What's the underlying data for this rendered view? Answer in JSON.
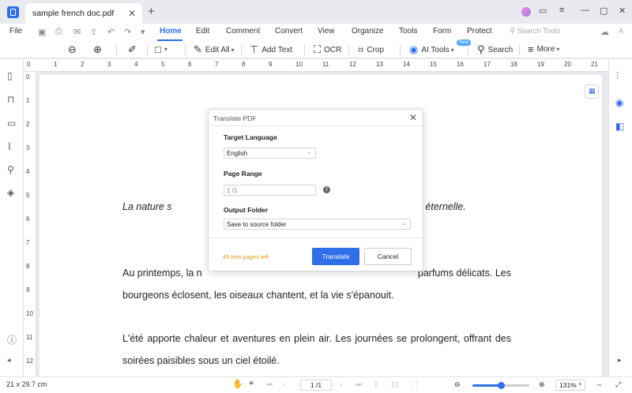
{
  "titlebar": {
    "tab_title": "sample french doc.pdf",
    "close_glyph": "✕",
    "new_tab_glyph": "+",
    "controls": {
      "feedback": "▭",
      "menu": "≡",
      "minimize": "—",
      "maximize": "▢",
      "close": "✕"
    }
  },
  "menubar": {
    "file": "File",
    "tabs": [
      "Home",
      "Edit",
      "Comment",
      "Convert",
      "View",
      "Organize",
      "Tools",
      "Form",
      "Protect"
    ],
    "active_tab": "Home",
    "search_tools_placeholder": "Search Tools"
  },
  "toolbar": {
    "edit_all": "Edit All",
    "add_text": "Add Text",
    "ocr": "OCR",
    "crop": "Crop",
    "ai_tools": "AI Tools",
    "ai_badge": "New",
    "search": "Search",
    "more": "More"
  },
  "ruler": {
    "top": [
      "0",
      "1",
      "2",
      "3",
      "4",
      "5",
      "6",
      "7",
      "8",
      "9",
      "10",
      "11",
      "12",
      "13",
      "14",
      "15",
      "16",
      "17",
      "18",
      "19",
      "20",
      "21"
    ],
    "left": [
      "0",
      "1",
      "2",
      "3",
      "4",
      "5",
      "6",
      "7",
      "8",
      "9",
      "10",
      "11",
      "12"
    ]
  },
  "document": {
    "line_italic_left": "La nature s",
    "line_italic_right": "é éternelle.",
    "para1_line1_left": "Au printemps, la n",
    "para1_line1_right": "parfums délicats. Les",
    "para1_line2": "bourgeons éclosent, les oiseaux chantent, et la vie s'épanouit.",
    "para2_line1": "L'été apporte chaleur et aventures en plein air. Les journées se prolongent, offrant des",
    "para2_line2": "soirées paisibles sous un ciel étoilé."
  },
  "dialog": {
    "title": "Translate PDF",
    "target_language_label": "Target Language",
    "target_language_value": "English",
    "page_range_label": "Page Range",
    "page_range_value": "1 /1",
    "info_glyph": "!",
    "output_folder_label": "Output Folder",
    "output_folder_value": "Save to source folder",
    "free_pages": "45 free pages left",
    "translate_button": "Translate",
    "cancel_button": "Cancel"
  },
  "statusbar": {
    "page_size": "21 x 29.7 cm",
    "page_indicator": "1 /1",
    "zoom": "131%",
    "zoom_fraction": 0.5
  },
  "colors": {
    "accent": "#2f6fe8",
    "free_pages": "#e49a18"
  }
}
